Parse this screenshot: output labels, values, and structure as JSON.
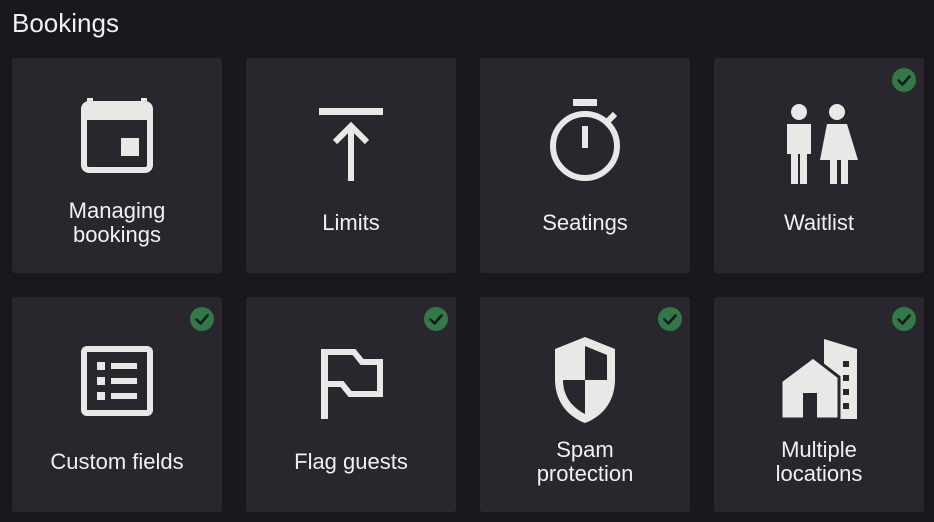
{
  "page": {
    "title": "Bookings"
  },
  "colors": {
    "background": "#1a171f",
    "tile": "#29262d",
    "icon": "#e9e8e6",
    "check": "#2f7a47",
    "text": "#f2f1f0"
  },
  "tiles": [
    {
      "label": "Managing\nbookings",
      "icon": "calendar-icon",
      "enabled": false
    },
    {
      "label": "Limits",
      "icon": "upload-arrow-icon",
      "enabled": false
    },
    {
      "label": "Seatings",
      "icon": "stopwatch-icon",
      "enabled": false
    },
    {
      "label": "Waitlist",
      "icon": "people-icon",
      "enabled": true
    },
    {
      "label": "Custom fields",
      "icon": "list-icon",
      "enabled": true
    },
    {
      "label": "Flag guests",
      "icon": "flag-icon",
      "enabled": true
    },
    {
      "label": "Spam\nprotection",
      "icon": "shield-icon",
      "enabled": true
    },
    {
      "label": "Multiple\nlocations",
      "icon": "buildings-icon",
      "enabled": true
    }
  ]
}
